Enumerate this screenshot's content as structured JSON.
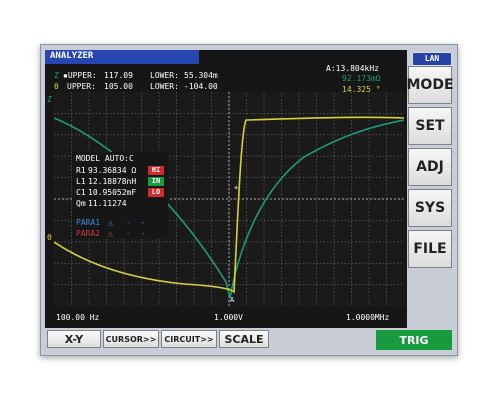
{
  "window": {
    "title": "ANALYZER",
    "network_badge": "LAN"
  },
  "header": {
    "z_row": {
      "marker": "Z",
      "upper_label": "▪UPPER:",
      "upper_value": "117.09",
      "lower_label": "LOWER:",
      "lower_value": "55.304m"
    },
    "theta_row": {
      "marker": "θ",
      "upper_label": "UPPER:",
      "upper_value": "105.00",
      "lower_label": "LOWER:",
      "lower_value": "-104.00"
    },
    "cursor": {
      "freq": "A:13.804kHz",
      "z_value": "92.173mΩ",
      "theta_value": "14.325 °"
    }
  },
  "plot": {
    "left_markers": {
      "top": "Z",
      "bottom": "θ"
    },
    "x_axis": {
      "start": "100.00 Hz",
      "mid": "1.000V",
      "end": "1.0000MHz"
    },
    "cursor_marker": "A"
  },
  "model_box": {
    "title": "MODEL AUTO:C",
    "params": [
      {
        "label": "R1",
        "value": "93.36834 Ω",
        "judge": "HI",
        "judge_color": "#d02b2b"
      },
      {
        "label": "L1",
        "value": "12.18878nH",
        "judge": "IN",
        "judge_color": "#1a9a3e"
      },
      {
        "label": "C1",
        "value": "10.95052mF",
        "judge": "LO",
        "judge_color": "#d02b2b"
      },
      {
        "label": "Qm",
        "value": "11.11274",
        "judge": "",
        "judge_color": ""
      }
    ],
    "para1": {
      "label": "PARA1",
      "symbol": "△",
      "value": "-  -"
    },
    "para2": {
      "label": "PARA2",
      "symbol": "△",
      "value": "-  -"
    }
  },
  "softkeys": [
    "MODE",
    "SET",
    "ADJ",
    "SYS",
    "FILE"
  ],
  "function_keys": {
    "xy": "X-Y",
    "cursor": "CURSOR>>",
    "circuit": "CIRCUIT>>",
    "scale": "SCALE",
    "trig": "TRIG"
  },
  "colors": {
    "z_trace": "#1f9a78",
    "theta_trace": "#d8d23a",
    "title_bar": "#2846b0",
    "trig": "#1a9a3e",
    "para1": "#3c8fe0",
    "para2": "#d23b3b"
  }
}
